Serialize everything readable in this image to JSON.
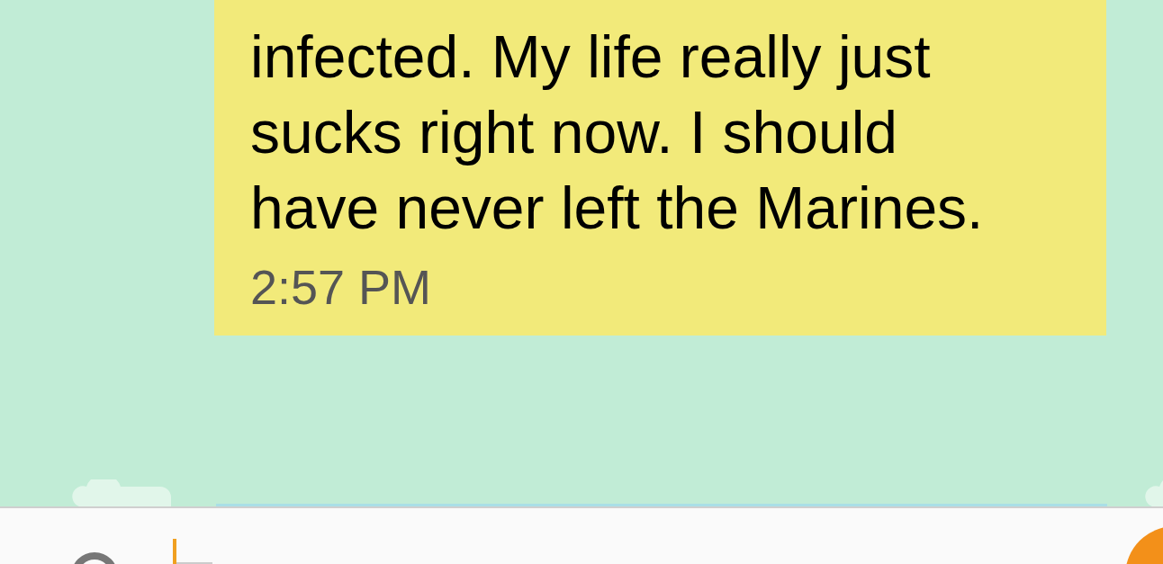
{
  "message": {
    "text": "infected. My life really just sucks right now. I should have never left the Marines.",
    "time": "2:57 PM"
  }
}
